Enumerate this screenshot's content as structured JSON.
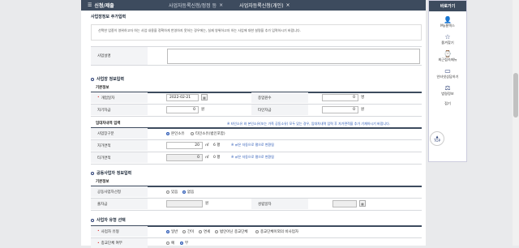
{
  "topbar": {
    "menu_label": "신청/제출",
    "tabs": [
      "사업자등록신청/정정 등",
      "사업자등록신청(개인)"
    ]
  },
  "notice": {
    "title": "사업장정보 추가입력",
    "text": "선택한 업종이 영위하고자 하는 사업 내용을 정확하게 반영하지 못하는 경우에는, 실제 영위하고자 하는 사업에 대한 설명을 추가 입력하시기 바랍니다."
  },
  "business_desc": {
    "label": "사업설명",
    "value": ""
  },
  "section_business": {
    "title": "사업장 정보입력",
    "sub": "기본정보"
  },
  "fields": {
    "open_date_label": "개업일자",
    "open_date_value": "2022-02-21",
    "employees_label": "종업원수",
    "employees_value": "0",
    "employees_unit": "명",
    "own_capital_label": "자기자금",
    "own_capital_value": "0",
    "own_capital_unit": "원",
    "other_capital_label": "타인자금",
    "other_capital_value": "0",
    "other_capital_unit": "원"
  },
  "lease": {
    "sub": "임대차내역 입력",
    "note": "※ 타인소유 와 본인소유(또는 가족 공동소유) 모두 있는 경우, 임대차내역 입력 후 자가면적을 추가 기재하시기 바랍니다.",
    "type_label": "사업장구분",
    "type_options": [
      "본인소유",
      "타인소유(법인포함)"
    ],
    "own_area_label": "자가면적",
    "own_area_value": "20",
    "own_area_unit": "㎡",
    "own_area_pyeong": "6 평",
    "other_area_label": "타가면적",
    "other_area_value": "0",
    "other_area_unit": "㎡",
    "other_area_pyeong": "0 평",
    "convert_hint": "※ ㎡은 자동으로 평으로 변환됨"
  },
  "joint": {
    "title": "공동사업자 정보입력",
    "sub": "기본정보",
    "type_label": "공동사업자선정",
    "options": [
      "있음",
      "없음"
    ],
    "capital_label": "출자금",
    "capital_unit": "원",
    "date_label": "성립일자"
  },
  "type_section": {
    "title": "사업자 유형 선택",
    "type_label": "사업자 유형",
    "type_options": [
      "일반",
      "간이",
      "면세",
      "법인아닌 종교단체",
      "종교단체이외의 비사업자"
    ],
    "simple_label": "종교단체 여부",
    "simple_options": [
      "예",
      "부"
    ]
  },
  "side": {
    "head": "바로가기",
    "items": [
      "My홈택스",
      "즐겨찾기",
      "최근접속메뉴",
      "인터넷상담하기",
      "법령정보",
      "접기"
    ],
    "top": "TOP"
  }
}
